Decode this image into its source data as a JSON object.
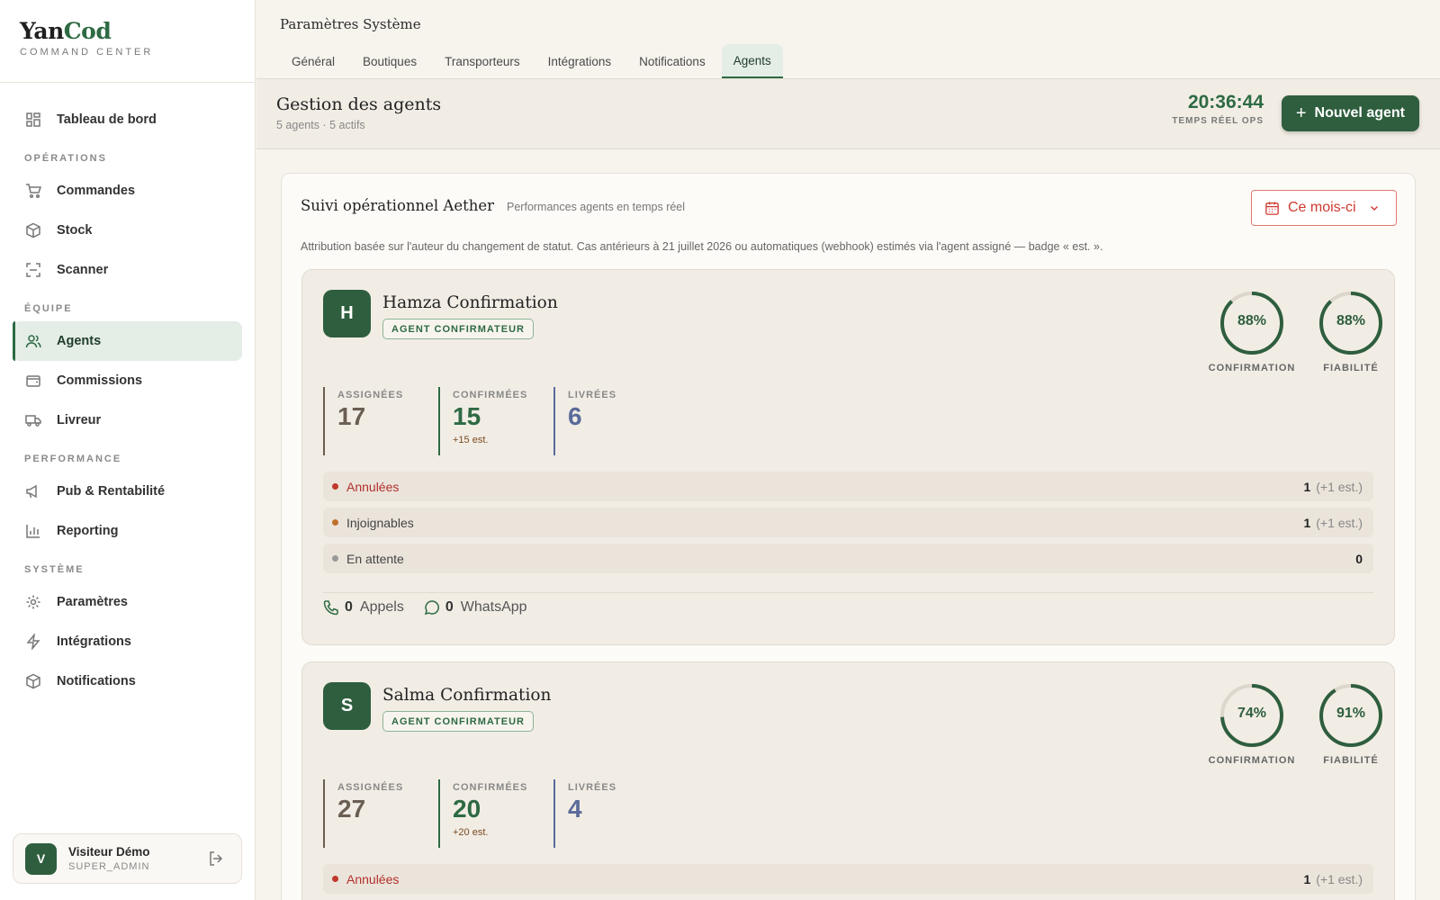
{
  "brand": {
    "name_part1": "Yan",
    "name_part2": "Cod",
    "subtitle": "COMMAND CENTER"
  },
  "sidebar": {
    "top_item": {
      "label": "Tableau de bord",
      "icon": "grid-icon"
    },
    "sections": [
      {
        "title": "OPÉRATIONS",
        "items": [
          {
            "label": "Commandes",
            "icon": "cart-icon"
          },
          {
            "label": "Stock",
            "icon": "box-icon"
          },
          {
            "label": "Scanner",
            "icon": "scan-icon"
          }
        ]
      },
      {
        "title": "ÉQUIPE",
        "items": [
          {
            "label": "Agents",
            "icon": "users-icon",
            "active": true
          },
          {
            "label": "Commissions",
            "icon": "wallet-icon"
          },
          {
            "label": "Livreur",
            "icon": "truck-icon"
          }
        ]
      },
      {
        "title": "PERFORMANCE",
        "items": [
          {
            "label": "Pub & Rentabilité",
            "icon": "megaphone-icon"
          },
          {
            "label": "Reporting",
            "icon": "bar-chart-icon"
          }
        ]
      },
      {
        "title": "SYSTÈME",
        "items": [
          {
            "label": "Paramètres",
            "icon": "gear-icon"
          },
          {
            "label": "Intégrations",
            "icon": "bolt-icon"
          },
          {
            "label": "Notifications",
            "icon": "box-icon"
          }
        ]
      }
    ],
    "user": {
      "initial": "V",
      "name": "Visiteur Démo",
      "role": "SUPER_ADMIN"
    }
  },
  "topbar": {
    "title": "Paramètres Système",
    "tabs": [
      "Général",
      "Boutiques",
      "Transporteurs",
      "Intégrations",
      "Notifications",
      "Agents"
    ],
    "active_tab": "Agents"
  },
  "header": {
    "title": "Gestion des agents",
    "subtitle": "5 agents · 5 actifs",
    "clock_time": "20:36:44",
    "clock_label": "TEMPS RÉEL OPS",
    "new_agent_label": "Nouvel agent"
  },
  "panel": {
    "title": "Suivi opérationnel Aether",
    "subtitle": "Performances agents en temps réel",
    "period": "Ce mois-ci",
    "note": "Attribution basée sur l'auteur du changement de statut. Cas antérieurs à 21 juillet 2026 ou automatiques (webhook) estimés via l'agent assigné — badge « est. »."
  },
  "labels": {
    "confirmation": "CONFIRMATION",
    "fiabilite": "FIABILITÉ",
    "assignees": "ASSIGNÉES",
    "confirmees": "CONFIRMÉES",
    "livrees": "LIVRÉES",
    "calls": "Appels",
    "whatsapp": "WhatsApp"
  },
  "agents": [
    {
      "initial": "H",
      "name": "Hamza Confirmation",
      "role": "AGENT CONFIRMATEUR",
      "confirmation_pct": "88%",
      "confirmation_value": 88,
      "fiabilite_pct": "88%",
      "fiabilite_value": 88,
      "assignees": "17",
      "confirmees": "15",
      "confirmees_est": "+15 est.",
      "livrees": "6",
      "statuses": [
        {
          "label": "Annulées",
          "count": "1",
          "est": "(+1 est.)",
          "color": "#c0392b"
        },
        {
          "label": "Injoignables",
          "count": "1",
          "est": "(+1 est.)",
          "color": "#c0702b"
        },
        {
          "label": "En attente",
          "count": "0",
          "est": "",
          "color": "#999999"
        }
      ],
      "calls": "0",
      "whatsapp": "0"
    },
    {
      "initial": "S",
      "name": "Salma Confirmation",
      "role": "AGENT CONFIRMATEUR",
      "confirmation_pct": "74%",
      "confirmation_value": 74,
      "fiabilite_pct": "91%",
      "fiabilite_value": 91,
      "assignees": "27",
      "confirmees": "20",
      "confirmees_est": "+20 est.",
      "livrees": "4",
      "statuses": [
        {
          "label": "Annulées",
          "count": "1",
          "est": "(+1 est.)",
          "color": "#c0392b"
        }
      ]
    }
  ]
}
